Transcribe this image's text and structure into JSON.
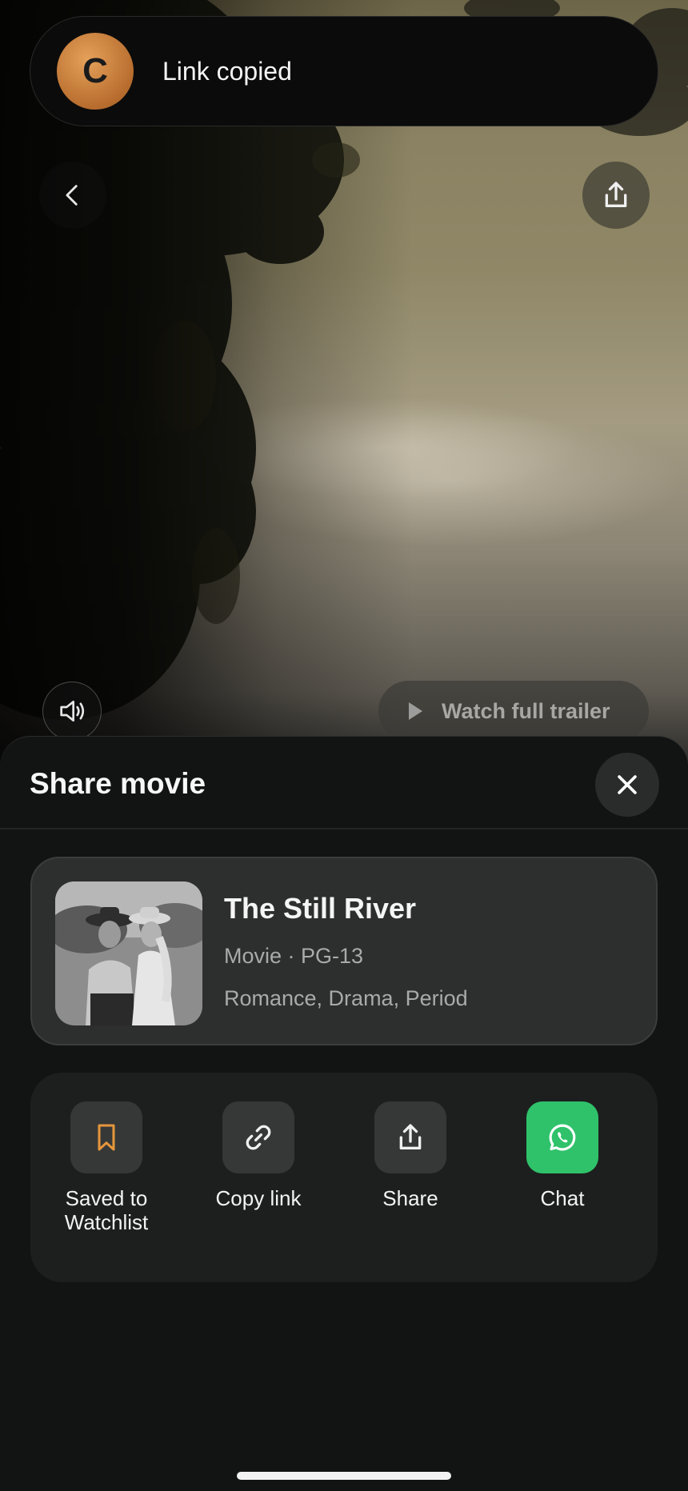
{
  "toast": {
    "avatar_letter": "C",
    "message": "Link copied"
  },
  "hero": {
    "back_icon": "chevron-left-icon",
    "share_icon": "share-icon",
    "volume_icon": "speaker-icon",
    "trailer_label": "Watch full trailer"
  },
  "sheet": {
    "title": "Share movie",
    "close_icon": "close-icon",
    "movie": {
      "title": "The Still River",
      "meta": "Movie · PG-13",
      "genres": "Romance, Drama, Period"
    },
    "actions": [
      {
        "label": "Saved to\nWatchlist",
        "icon": "bookmark-icon",
        "accent": "#e6963b"
      },
      {
        "label": "Copy link",
        "icon": "link-icon"
      },
      {
        "label": "Share",
        "icon": "share-icon"
      },
      {
        "label": "Chat",
        "icon": "whatsapp-icon",
        "accent": "#2fc26a"
      }
    ]
  }
}
